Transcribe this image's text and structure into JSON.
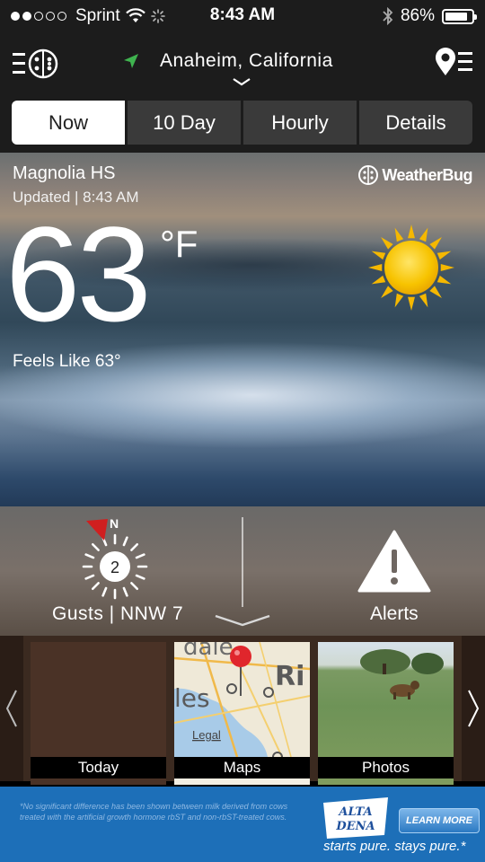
{
  "status_bar": {
    "carrier": "Sprint",
    "time": "8:43 AM",
    "battery_percent": "86%",
    "battery_level": 0.86,
    "signal_bars_filled": 2,
    "signal_bars_total": 5
  },
  "header": {
    "location": "Anaheim, California",
    "icons": [
      "menu-weatherbug-icon",
      "location-arrow-icon",
      "chevron-down-icon",
      "location-list-icon"
    ]
  },
  "tabs": [
    {
      "label": "Now",
      "active": true
    },
    {
      "label": "10 Day",
      "active": false
    },
    {
      "label": "Hourly",
      "active": false
    },
    {
      "label": "Details",
      "active": false
    }
  ],
  "current": {
    "station": "Magnolia HS",
    "updated": "Updated | 8:43 AM",
    "brand": "WeatherBug",
    "temperature": "63",
    "unit": "°F",
    "feels_like": "Feels Like 63°",
    "condition_icon": "sunny-icon"
  },
  "wind": {
    "compass_label": "N",
    "speed_badge": "2",
    "gusts": "Gusts | NNW 7"
  },
  "alerts": {
    "label": "Alerts"
  },
  "thumbnails": [
    {
      "caption": "Today"
    },
    {
      "caption": "Maps",
      "map_labels": [
        "dale",
        "Ri",
        "les",
        "Legal"
      ]
    },
    {
      "caption": "Photos"
    }
  ],
  "ad": {
    "fine_print": "*No significant difference has been shown between milk derived from cows treated with the artificial growth hormone rbST and non-rbST-treated cows.",
    "brand": "ALTA DENA",
    "cta": "LEARN MORE",
    "tagline": "starts pure. stays pure.*"
  },
  "colors": {
    "bar_bg": "#1c1c1c",
    "tab_bg": "#3a3a3a",
    "tab_active_bg": "#ffffff",
    "sun_yellow": "#f7c300",
    "compass_red": "#d01f1f",
    "map_pin_red": "#e0262c",
    "ad_blue": "#1d6fb8"
  }
}
